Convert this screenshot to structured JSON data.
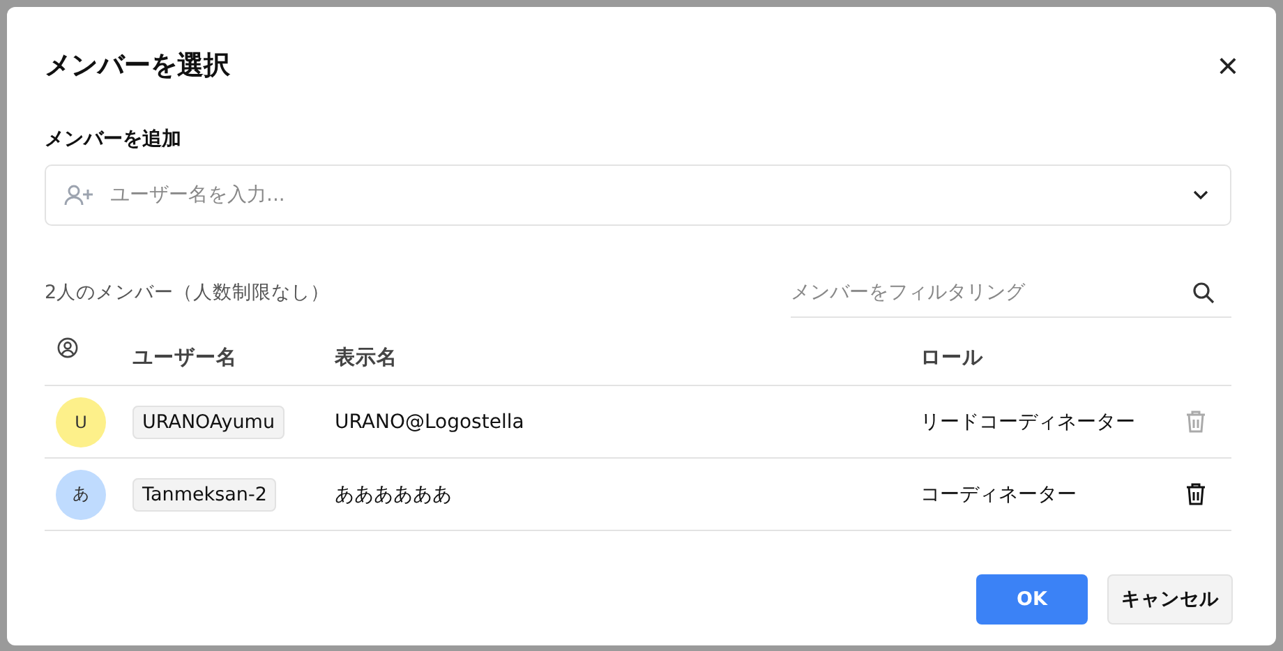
{
  "dialog": {
    "title": "メンバーを選択",
    "close": "×"
  },
  "add_member": {
    "label": "メンバーを追加",
    "placeholder": "ユーザー名を入力..."
  },
  "member_count": "2人のメンバー（人数制限なし）",
  "filter": {
    "placeholder": "メンバーをフィルタリング"
  },
  "table": {
    "columns": [
      "ユーザー名",
      "表示名",
      "ロール"
    ],
    "rows": [
      {
        "avatar": "U",
        "color": "#fdf08a",
        "username": "URANOAyumu",
        "display_name": "URANO@Logostella",
        "role": "リードコーディネーター",
        "delete_disabled": true
      },
      {
        "avatar": "あ",
        "color": "#bfdbfe",
        "username": "Tanmeksan-2",
        "display_name": "ああああああ",
        "role": "コーディネーター",
        "delete_disabled": false
      }
    ]
  },
  "buttons": [
    {
      "label": "OK",
      "kind": "primary"
    },
    {
      "label": "キャンセル",
      "kind": "secondary"
    }
  ]
}
